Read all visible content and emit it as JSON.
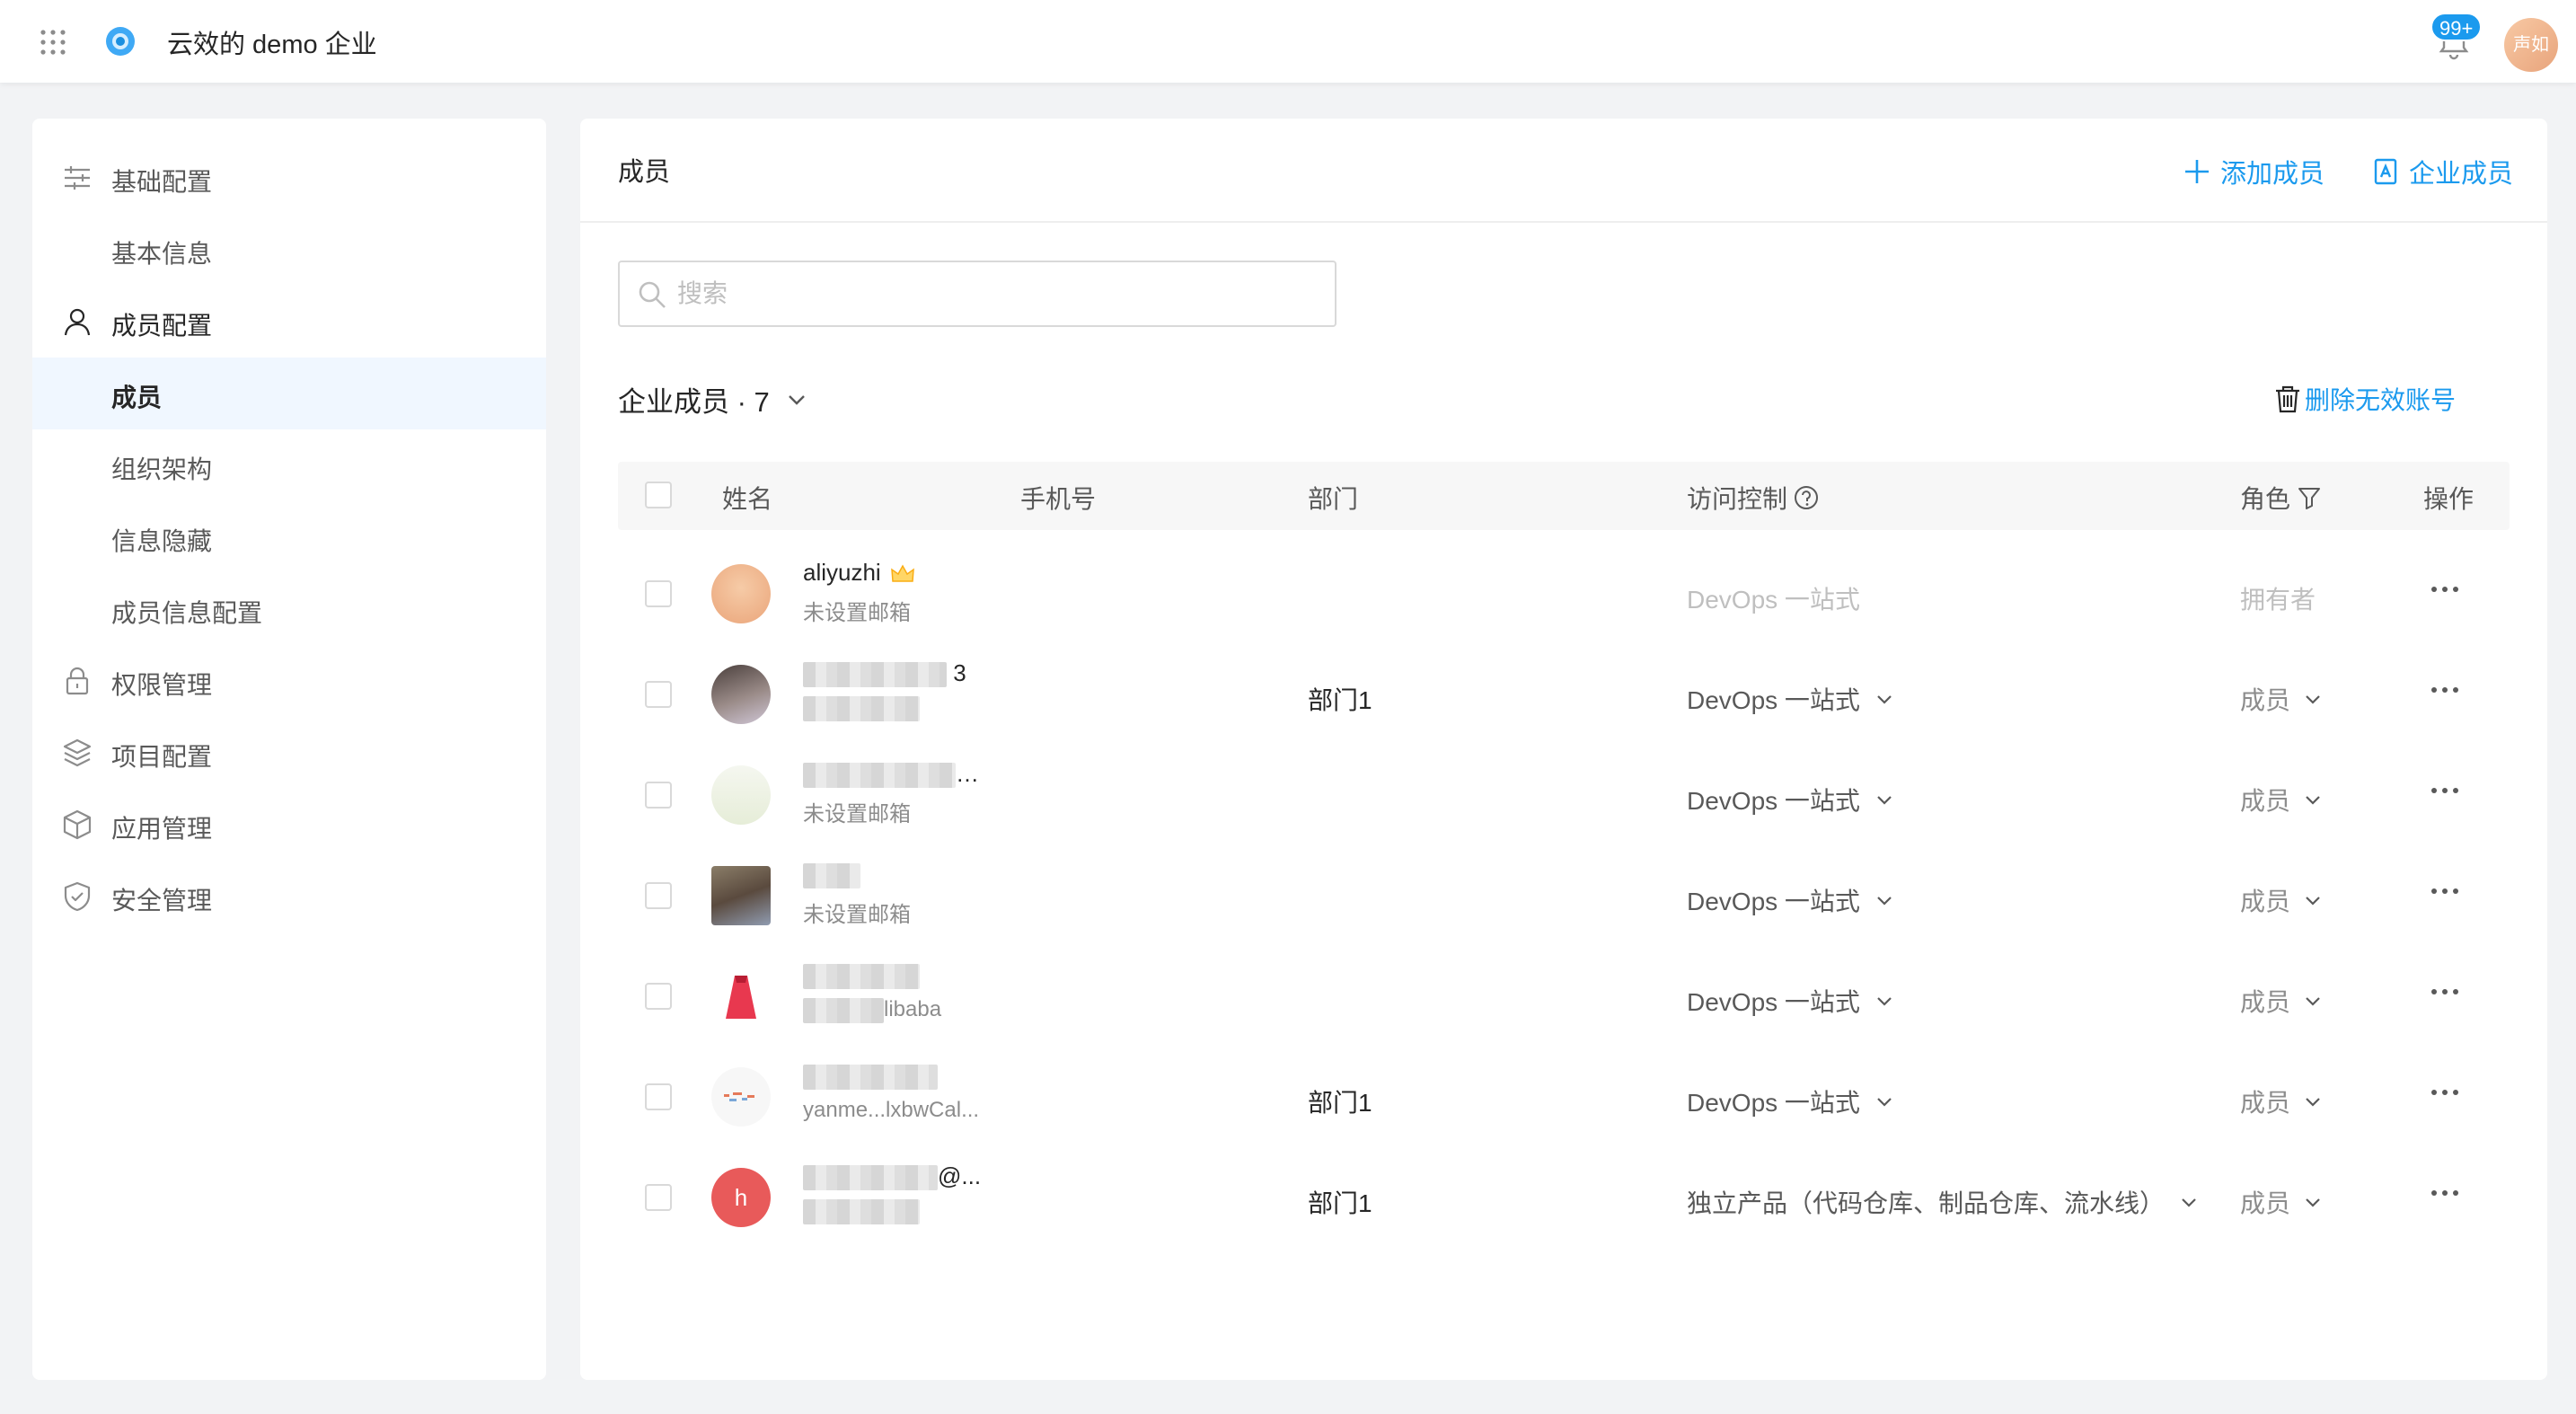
{
  "topbar": {
    "org_name": "云效的 demo 企业",
    "notification_badge": "99+",
    "user_avatar_text": "声如"
  },
  "sidebar": {
    "items": [
      {
        "label": "基础配置",
        "icon": "sliders-icon",
        "type": "group"
      },
      {
        "label": "基本信息",
        "type": "sub"
      },
      {
        "label": "成员配置",
        "icon": "user-icon",
        "type": "group"
      },
      {
        "label": "成员",
        "type": "sub",
        "active": true
      },
      {
        "label": "组织架构",
        "type": "sub"
      },
      {
        "label": "信息隐藏",
        "type": "sub"
      },
      {
        "label": "成员信息配置",
        "type": "sub"
      },
      {
        "label": "权限管理",
        "icon": "lock-icon",
        "type": "group"
      },
      {
        "label": "项目配置",
        "icon": "layers-icon",
        "type": "group"
      },
      {
        "label": "应用管理",
        "icon": "box-icon",
        "type": "group"
      },
      {
        "label": "安全管理",
        "icon": "shield-icon",
        "type": "group"
      }
    ]
  },
  "main": {
    "title": "成员",
    "add_member": "添加成员",
    "enterprise_member": "企业成员",
    "search_placeholder": "搜索",
    "section_title": "企业成员 · 7",
    "delete_invalid": "删除无效账号"
  },
  "table": {
    "columns": {
      "name": "姓名",
      "phone": "手机号",
      "dept": "部门",
      "access": "访问控制",
      "role": "角色",
      "actions": "操作"
    },
    "rows": [
      {
        "name": "aliyuzhi",
        "email": "未设置邮箱",
        "dept": "",
        "access": "DevOps 一站式",
        "role": "拥有者",
        "owner": true,
        "avatar_color": "#f3c19a"
      },
      {
        "name": "3",
        "email": "",
        "dept": "部门1",
        "access": "DevOps 一站式",
        "role": "成员",
        "avatar_color": "#6d5f5c"
      },
      {
        "name": "…",
        "email": "未设置邮箱",
        "dept": "",
        "access": "DevOps 一站式",
        "role": "成员",
        "avatar_color": "#eef3e6"
      },
      {
        "name": "",
        "email": "未设置邮箱",
        "dept": "",
        "access": "DevOps 一站式",
        "role": "成员",
        "avatar_color": "#7b6e5a"
      },
      {
        "name": "",
        "email": "libaba",
        "dept": "",
        "access": "DevOps 一站式",
        "role": "成员",
        "avatar_color": "#ffffff"
      },
      {
        "name": "",
        "email": "yanme...lxbwCal...",
        "dept": "部门1",
        "access": "DevOps 一站式",
        "role": "成员",
        "avatar_color": "#f4f4f4"
      },
      {
        "name": "@...",
        "email": "",
        "dept": "部门1",
        "access": "独立产品（代码仓库、制品仓库、流水线）",
        "role": "成员",
        "avatar_color": "#e85a5a",
        "avatar_letter": "h"
      }
    ]
  }
}
